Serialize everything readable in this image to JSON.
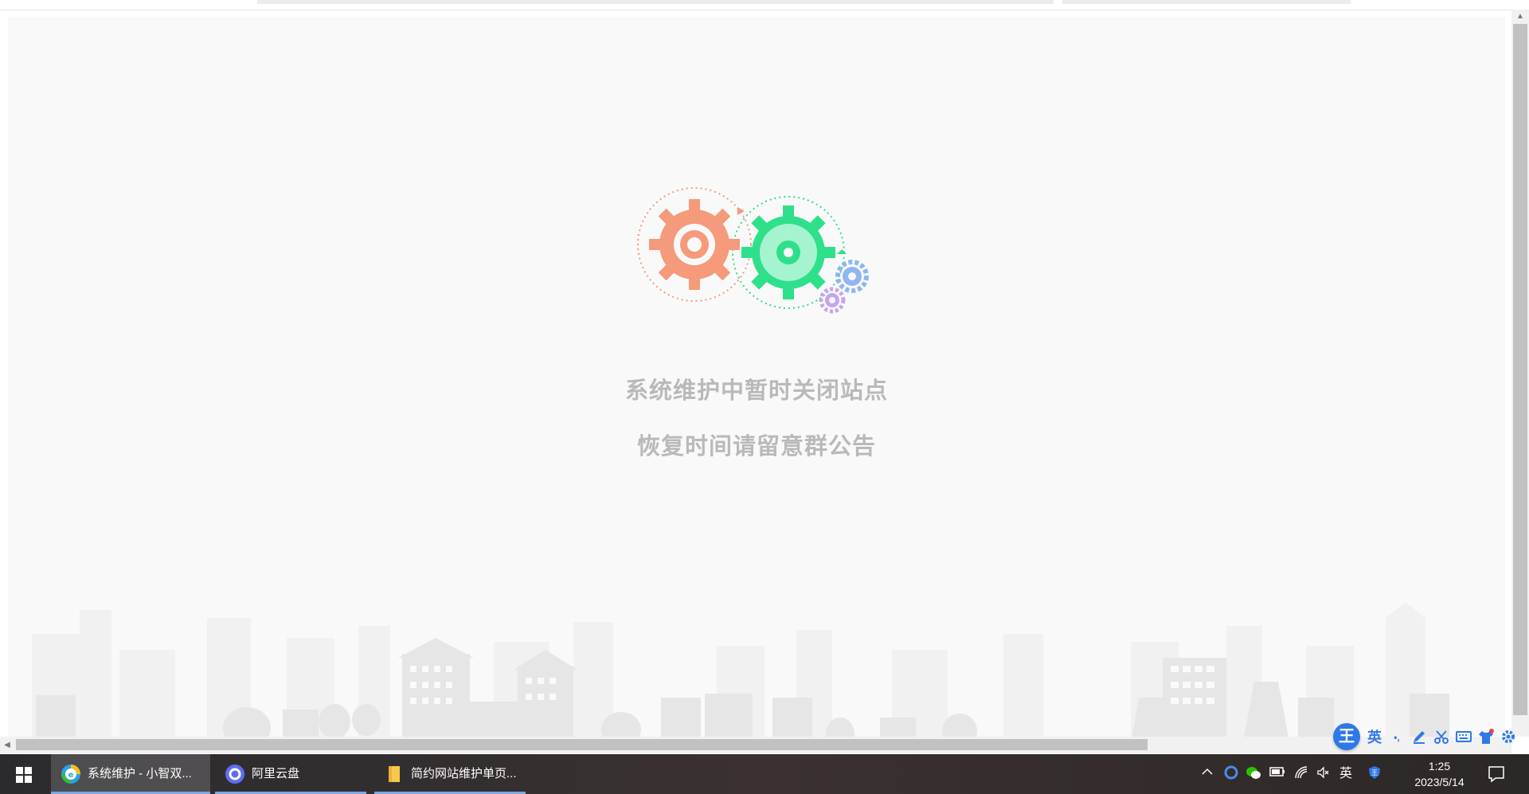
{
  "page": {
    "message_line1": "系统维护中暂时关闭站点",
    "message_line2": "恢复时间请留意群公告",
    "background_color": "#f9f9f9",
    "text_color": "#b9b9b9"
  },
  "illustration": {
    "gear_left_color": "#f59a7a",
    "gear_right_color": "#2ee08a",
    "gear_small_blue": "#8fb6f2",
    "gear_small_purple": "#c7a4ee"
  },
  "ime_toolbar": {
    "logo": "王",
    "lang": "英",
    "punct": "•,",
    "icons": [
      "pen-icon",
      "scissors-icon",
      "keyboard-icon",
      "shirt-icon",
      "gear-icon"
    ]
  },
  "taskbar": {
    "apps": [
      {
        "label": "系统维护 - 小智双...",
        "icon": "browser-icon"
      },
      {
        "label": "阿里云盘",
        "icon": "aliyun-drive-icon"
      },
      {
        "label": "简约网站维护单页...",
        "icon": "folder-icon"
      }
    ],
    "tray_lang": "英",
    "time": "1:25",
    "date": "2023/5/14"
  }
}
